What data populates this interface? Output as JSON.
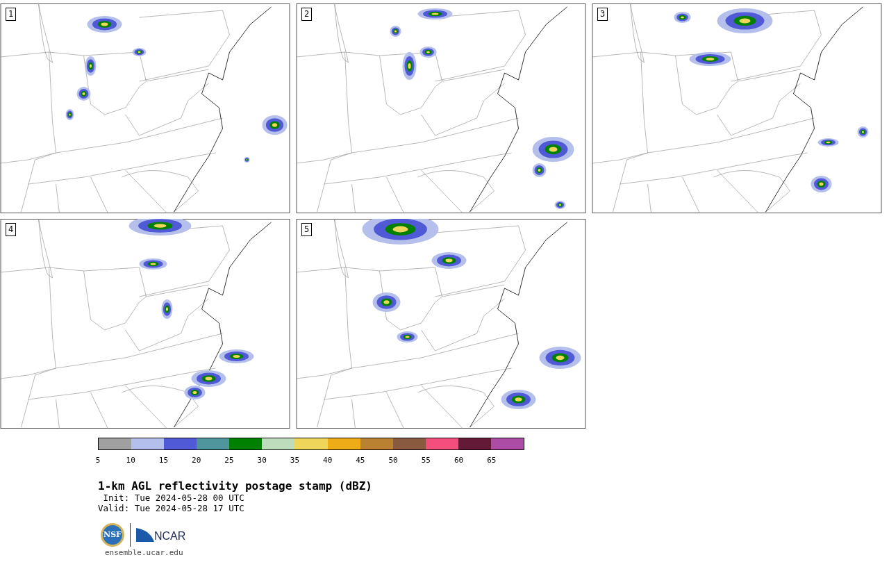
{
  "panels": [
    {
      "label": "1"
    },
    {
      "label": "2"
    },
    {
      "label": "3"
    },
    {
      "label": "4"
    },
    {
      "label": "5"
    }
  ],
  "legend": {
    "segments": [
      {
        "color": "#a0a0a0"
      },
      {
        "color": "#b4bfec"
      },
      {
        "color": "#505ad6"
      },
      {
        "color": "#4e969c"
      },
      {
        "color": "#008000"
      },
      {
        "color": "#bcdcbc"
      },
      {
        "color": "#eed65a"
      },
      {
        "color": "#eeac16"
      },
      {
        "color": "#ba8230"
      },
      {
        "color": "#8a5a3e"
      },
      {
        "color": "#f44f7c"
      },
      {
        "color": "#641a36"
      },
      {
        "color": "#ac4ca4"
      }
    ],
    "ticks": [
      "5",
      "10",
      "15",
      "20",
      "25",
      "30",
      "35",
      "40",
      "45",
      "50",
      "55",
      "60",
      "65"
    ]
  },
  "title": "1-km AGL reflectivity postage stamp (dBZ)",
  "init": " Init: Tue 2024-05-28 00 UTC",
  "valid": "Valid: Tue 2024-05-28 17 UTC",
  "logos": {
    "nsf": "NSF",
    "ncar": "NCAR"
  },
  "url": "ensemble.ucar.edu"
}
